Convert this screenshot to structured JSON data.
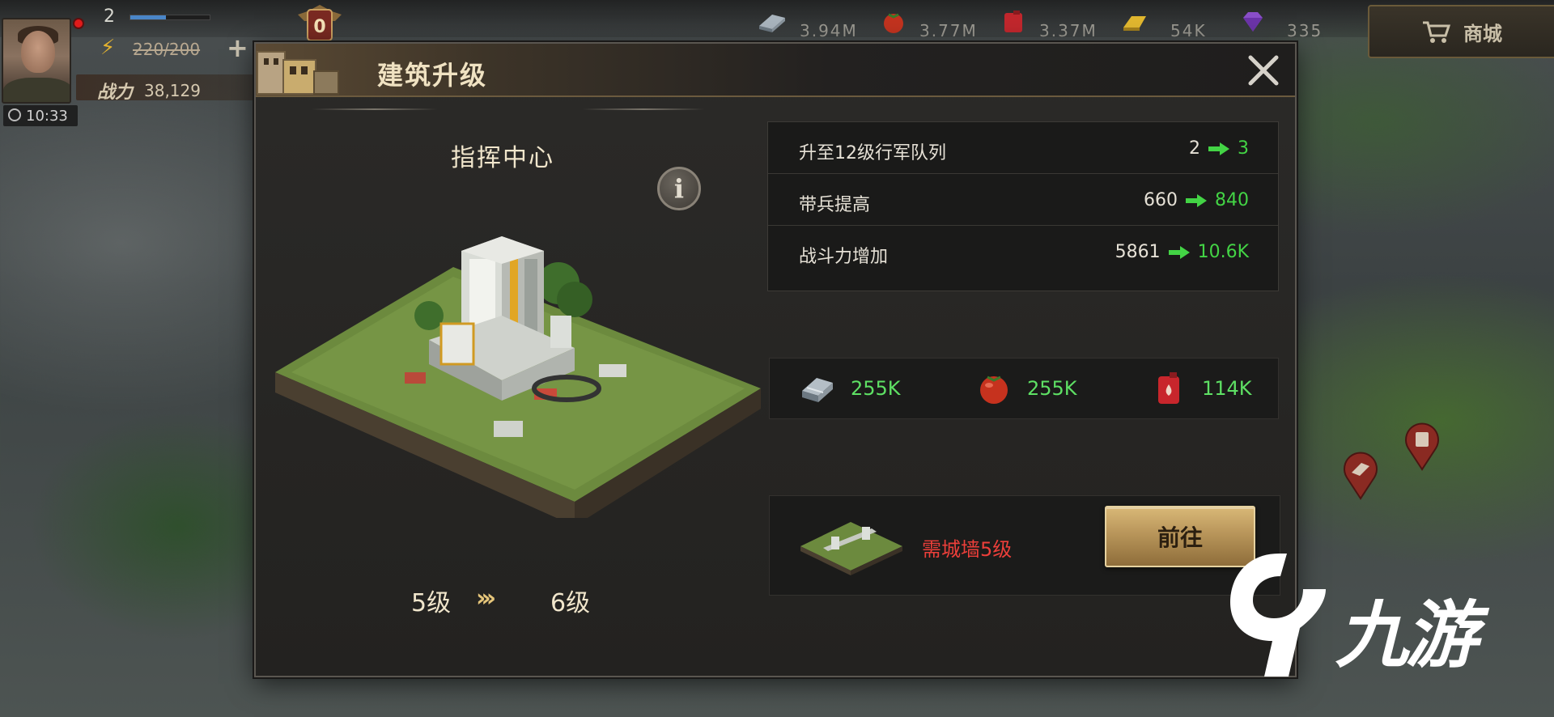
{
  "player": {
    "level": "2",
    "xp_fraction": 0.45,
    "energy": "220/200",
    "power_label": "战力",
    "power_value": "38,129",
    "timer": "10:33",
    "rank": "0"
  },
  "resources": [
    {
      "icon": "steel-icon",
      "value": "3.94M"
    },
    {
      "icon": "food-icon",
      "value": "3.77M"
    },
    {
      "icon": "oil-icon",
      "value": "3.37M"
    },
    {
      "icon": "gold-icon",
      "value": "54K"
    },
    {
      "icon": "gem-icon",
      "value": "335"
    }
  ],
  "shop": {
    "label": "商城",
    "icon": "cart-icon"
  },
  "dialog": {
    "title": "建筑升级",
    "building_name": "指挥中心",
    "level_from": "5级",
    "level_arrows": "›››",
    "level_to": "6级",
    "stats": [
      {
        "label": "升至12级行军队列",
        "old": "2",
        "new": "3"
      },
      {
        "label": "带兵提高",
        "old": "660",
        "new": "840"
      },
      {
        "label": "战斗力增加",
        "old": "5861",
        "new": "10.6K"
      }
    ],
    "costs": [
      {
        "icon": "steel-icon",
        "value": "255K"
      },
      {
        "icon": "food-icon",
        "value": "255K"
      },
      {
        "icon": "oil-icon",
        "value": "114K"
      }
    ],
    "requirement": {
      "text": "需城墙5级",
      "button": "前往"
    }
  },
  "watermark": {
    "text": "九游"
  },
  "colors": {
    "accent_green": "#43d445",
    "requirement_red": "#ec3f3a",
    "gold_button": "#c9a25f",
    "title_text": "#f0e2c2"
  }
}
